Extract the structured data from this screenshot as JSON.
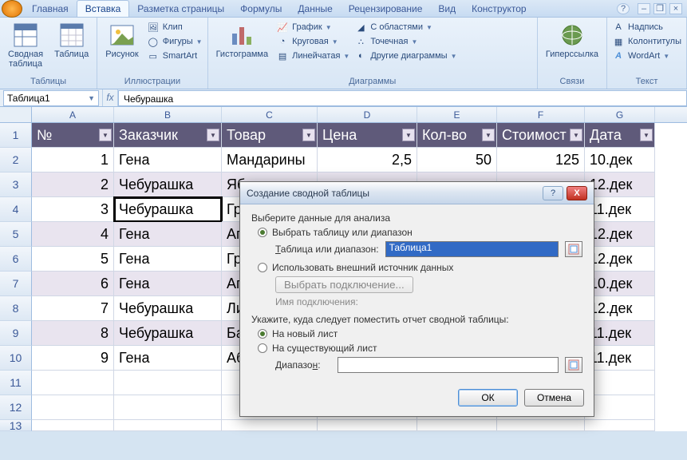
{
  "tabs": [
    "Главная",
    "Вставка",
    "Разметка страницы",
    "Формулы",
    "Данные",
    "Рецензирование",
    "Вид",
    "Конструктор"
  ],
  "active_tab": 1,
  "ribbon": {
    "tables": {
      "label": "Таблицы",
      "pivot": "Сводная\nтаблица",
      "table": "Таблица"
    },
    "illustrations": {
      "label": "Иллюстрации",
      "picture": "Рисунок",
      "clip": "Клип",
      "shapes": "Фигуры",
      "smartart": "SmartArt"
    },
    "charts": {
      "label": "Диаграммы",
      "histogram": "Гистограмма",
      "line": "График",
      "pie": "Круговая",
      "bar": "Линейчатая",
      "area": "С областями",
      "scatter": "Точечная",
      "other": "Другие диаграммы"
    },
    "links": {
      "label": "Связи",
      "hyperlink": "Гиперссылка"
    },
    "text": {
      "label": "Текст",
      "textbox": "Надпись",
      "headerfooter": "Колонтитулы",
      "wordart": "WordArt"
    }
  },
  "name_box": "Таблица1",
  "formula": "Чебурашка",
  "columns": [
    "A",
    "B",
    "C",
    "D",
    "E",
    "F",
    "G"
  ],
  "headers": [
    "№",
    "Заказчик",
    "Товар",
    "Цена",
    "Кол-во",
    "Стоимост",
    "Дата"
  ],
  "rows": [
    {
      "n": "1",
      "cust": "Гена",
      "prod": "Мандарины",
      "price": "2,5",
      "qty": "50",
      "cost": "125",
      "date": "10.дек"
    },
    {
      "n": "2",
      "cust": "Чебурашка",
      "prod": "Яб",
      "price": "",
      "qty": "",
      "cost": "",
      "date": "12.дек"
    },
    {
      "n": "3",
      "cust": "Чебурашка",
      "prod": "Гр",
      "price": "",
      "qty": "",
      "cost": "",
      "date": "11.дек"
    },
    {
      "n": "4",
      "cust": "Гена",
      "prod": "Ап",
      "price": "",
      "qty": "",
      "cost": "",
      "date": "12.дек"
    },
    {
      "n": "5",
      "cust": "Гена",
      "prod": "Гр",
      "price": "",
      "qty": "",
      "cost": "",
      "date": "12.дек"
    },
    {
      "n": "6",
      "cust": "Гена",
      "prod": "Ап",
      "price": "",
      "qty": "",
      "cost": "",
      "date": "10.дек"
    },
    {
      "n": "7",
      "cust": "Чебурашка",
      "prod": "Ли",
      "price": "",
      "qty": "",
      "cost": "",
      "date": "12.дек"
    },
    {
      "n": "8",
      "cust": "Чебурашка",
      "prod": "Ба",
      "price": "",
      "qty": "",
      "cost": "",
      "date": "11.дек"
    },
    {
      "n": "9",
      "cust": "Гена",
      "prod": "Аб",
      "price": "",
      "qty": "",
      "cost": "",
      "date": "11.дек"
    }
  ],
  "dialog": {
    "title": "Создание сводной таблицы",
    "prompt1": "Выберите данные для анализа",
    "opt_range": "Выбрать таблицу или диапазон",
    "range_label": "Таблица или диапазон:",
    "range_value": "Таблица1",
    "opt_external": "Использовать внешний источник данных",
    "choose_conn": "Выбрать подключение...",
    "conn_name": "Имя подключения:",
    "prompt2": "Укажите, куда следует поместить отчет сводной таблицы:",
    "opt_newsheet": "На новый лист",
    "opt_existing": "На существующий лист",
    "range2_label": "Диапазон:",
    "ok": "ОК",
    "cancel": "Отмена"
  }
}
